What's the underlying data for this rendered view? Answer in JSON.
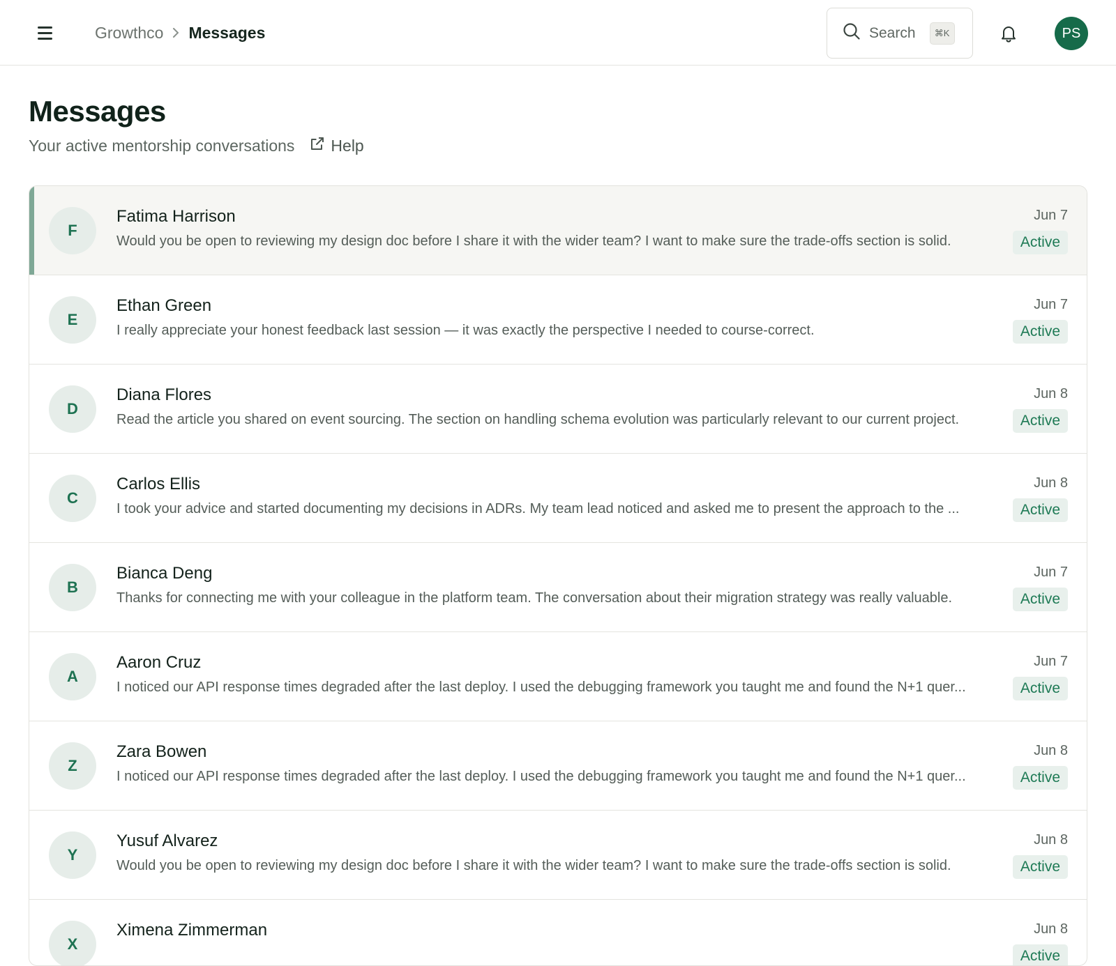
{
  "header": {
    "breadcrumb_root": "Growthco",
    "breadcrumb_current": "Messages",
    "search_label": "Search",
    "search_shortcut": "⌘K",
    "user_initials": "PS"
  },
  "page": {
    "title": "Messages",
    "subtitle": "Your active mentorship conversations",
    "help_label": "Help"
  },
  "conversations": [
    {
      "initial": "F",
      "name": "Fatima Harrison",
      "preview": "Would you be open to reviewing my design doc before I share it with the wider team? I want to make sure the trade-offs section is solid.",
      "date": "Jun 7",
      "status": "Active"
    },
    {
      "initial": "E",
      "name": "Ethan Green",
      "preview": "I really appreciate your honest feedback last session — it was exactly the perspective I needed to course-correct.",
      "date": "Jun 7",
      "status": "Active"
    },
    {
      "initial": "D",
      "name": "Diana Flores",
      "preview": "Read the article you shared on event sourcing. The section on handling schema evolution was particularly relevant to our current project.",
      "date": "Jun 8",
      "status": "Active"
    },
    {
      "initial": "C",
      "name": "Carlos Ellis",
      "preview": "I took your advice and started documenting my decisions in ADRs. My team lead noticed and asked me to present the approach to the ...",
      "date": "Jun 8",
      "status": "Active"
    },
    {
      "initial": "B",
      "name": "Bianca Deng",
      "preview": "Thanks for connecting me with your colleague in the platform team. The conversation about their migration strategy was really valuable.",
      "date": "Jun 7",
      "status": "Active"
    },
    {
      "initial": "A",
      "name": "Aaron Cruz",
      "preview": "I noticed our API response times degraded after the last deploy. I used the debugging framework you taught me and found the N+1 quer...",
      "date": "Jun 7",
      "status": "Active"
    },
    {
      "initial": "Z",
      "name": "Zara Bowen",
      "preview": "I noticed our API response times degraded after the last deploy. I used the debugging framework you taught me and found the N+1 quer...",
      "date": "Jun 8",
      "status": "Active"
    },
    {
      "initial": "Y",
      "name": "Yusuf Alvarez",
      "preview": "Would you be open to reviewing my design doc before I share it with the wider team? I want to make sure the trade-offs section is solid.",
      "date": "Jun 8",
      "status": "Active"
    },
    {
      "initial": "X",
      "name": "Ximena Zimmerman",
      "preview": "",
      "date": "Jun 8",
      "status": "Active"
    }
  ]
}
